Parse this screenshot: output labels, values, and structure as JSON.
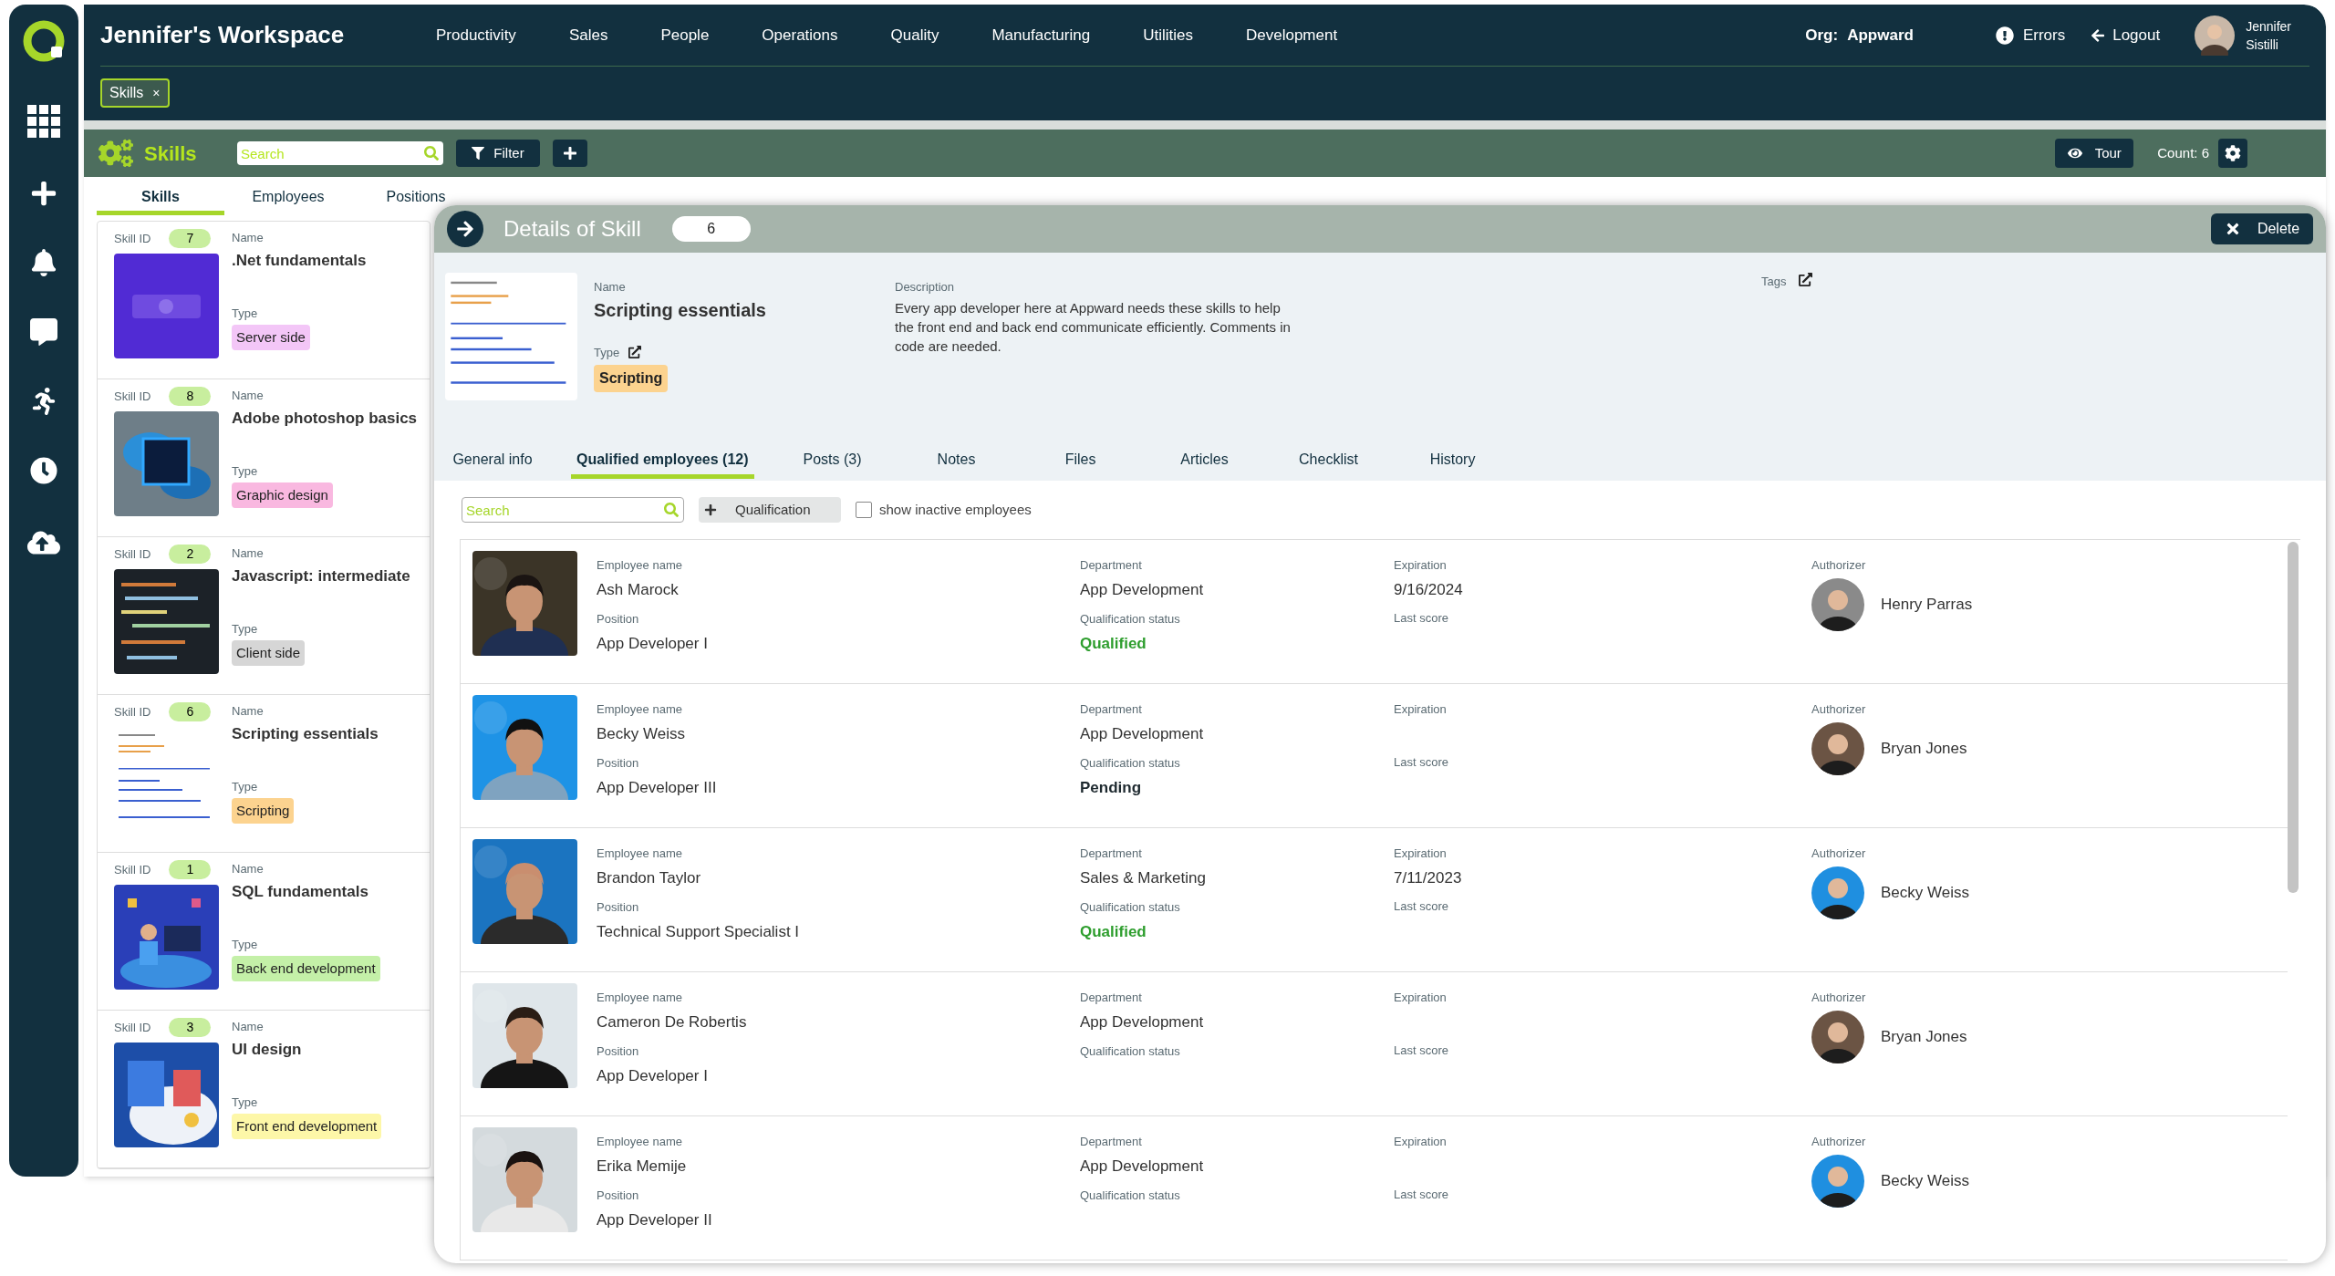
{
  "workspace": {
    "title": "Jennifer's Workspace"
  },
  "nav": [
    "Productivity",
    "Sales",
    "People",
    "Operations",
    "Quality",
    "Manufacturing",
    "Utilities",
    "Development"
  ],
  "org": {
    "label": "Org:",
    "value": "Appward"
  },
  "errors": "Errors",
  "logout": "Logout",
  "user": {
    "first": "Jennifer",
    "last": "Sistilli"
  },
  "open_tabs": [
    {
      "label": "Skills",
      "close": "×",
      "selected": true
    }
  ],
  "toolbar": {
    "title": "Skills",
    "search": {
      "placeholder": "Search"
    },
    "filter": "Filter",
    "tour": "Tour",
    "count": "Count: 6"
  },
  "list_tabs": [
    {
      "label": "Skills",
      "selected": true
    },
    {
      "label": "Employees",
      "selected": false
    },
    {
      "label": "Positions",
      "selected": false
    }
  ],
  "skills": [
    {
      "id_label": "Skill ID",
      "id": "7",
      "name_label": "Name",
      "name": ".Net fundamentals",
      "type_label": "Type",
      "type": "Server side",
      "color": "#f3c6f7"
    },
    {
      "id_label": "Skill ID",
      "id": "8",
      "name_label": "Name",
      "name": "Adobe photoshop basics",
      "type_label": "Type",
      "type": "Graphic design",
      "color": "#f9b8e0"
    },
    {
      "id_label": "Skill ID",
      "id": "2",
      "name_label": "Name",
      "name": "Javascript: intermediate",
      "type_label": "Type",
      "type": "Client side",
      "color": "#d6d6d6"
    },
    {
      "id_label": "Skill ID",
      "id": "6",
      "name_label": "Name",
      "name": "Scripting essentials",
      "type_label": "Type",
      "type": "Scripting",
      "color": "#fcd38f"
    },
    {
      "id_label": "Skill ID",
      "id": "1",
      "name_label": "Name",
      "name": "SQL fundamentals",
      "type_label": "Type",
      "type": "Back end development",
      "color": "#c4f0a8"
    },
    {
      "id_label": "Skill ID",
      "id": "3",
      "name_label": "Name",
      "name": "UI design",
      "type_label": "Type",
      "type": "Front end development",
      "color": "#fdf7a8"
    }
  ],
  "details": {
    "title": "Details of Skill",
    "id": "6",
    "delete": "Delete",
    "name_label": "Name",
    "name": "Scripting essentials",
    "type_label": "Type",
    "type": {
      "text": "Scripting",
      "color": "#fcd38f"
    },
    "description_label": "Description",
    "description": "Every app developer here at Appward needs these skills to help the front end and back end communicate efficiently. Comments in code are needed.",
    "tags_label": "Tags",
    "tabs": [
      {
        "label": "General info",
        "selected": false
      },
      {
        "label": "Qualified employees (12)",
        "selected": true
      },
      {
        "label": "Posts (3)",
        "selected": false
      },
      {
        "label": "Notes",
        "selected": false
      },
      {
        "label": "Files",
        "selected": false
      },
      {
        "label": "Articles",
        "selected": false
      },
      {
        "label": "Checklist",
        "selected": false
      },
      {
        "label": "History",
        "selected": false
      }
    ],
    "search": {
      "placeholder": "Search"
    },
    "add_qualification": "Qualification",
    "show_inactive": {
      "label": "show inactive employees",
      "checked": false
    },
    "rows": [
      {
        "name_label": "Employee name",
        "name": "Ash Marock",
        "position_label": "Position",
        "position": "App Developer I",
        "department_label": "Department",
        "department": "App Development",
        "status_label": "Qualification status",
        "status": {
          "text": "Qualified",
          "color": "#2e9e2e"
        },
        "expiration_label": "Expiration",
        "expiration": "9/16/2024",
        "score_label": "Last score",
        "authorizer_label": "Authorizer",
        "authorizer": "Henry Parras"
      },
      {
        "name_label": "Employee name",
        "name": "Becky Weiss",
        "position_label": "Position",
        "position": "App Developer III",
        "department_label": "Department",
        "department": "App Development",
        "status_label": "Qualification status",
        "status": {
          "text": "Pending",
          "color": "#1f2a30"
        },
        "expiration_label": "Expiration",
        "score_label": "Last score",
        "authorizer_label": "Authorizer",
        "authorizer": "Bryan Jones"
      },
      {
        "name_label": "Employee name",
        "name": "Brandon Taylor",
        "position_label": "Position",
        "position": "Technical Support Specialist I",
        "department_label": "Department",
        "department": "Sales & Marketing",
        "status_label": "Qualification status",
        "status": {
          "text": "Qualified",
          "color": "#2e9e2e"
        },
        "expiration_label": "Expiration",
        "expiration": "7/11/2023",
        "score_label": "Last score",
        "authorizer_label": "Authorizer",
        "authorizer": "Becky Weiss"
      },
      {
        "name_label": "Employee name",
        "name": "Cameron De Robertis",
        "position_label": "Position",
        "position": "App Developer I",
        "department_label": "Department",
        "department": "App Development",
        "status_label": "Qualification status",
        "expiration_label": "Expiration",
        "score_label": "Last score",
        "authorizer_label": "Authorizer",
        "authorizer": "Bryan Jones"
      },
      {
        "name_label": "Employee name",
        "name": "Erika Memije",
        "position_label": "Position",
        "position": "App Developer II",
        "department_label": "Department",
        "department": "App Development",
        "status_label": "Qualification status",
        "expiration_label": "Expiration",
        "score_label": "Last score",
        "authorizer_label": "Authorizer",
        "authorizer": "Becky Weiss"
      }
    ]
  }
}
